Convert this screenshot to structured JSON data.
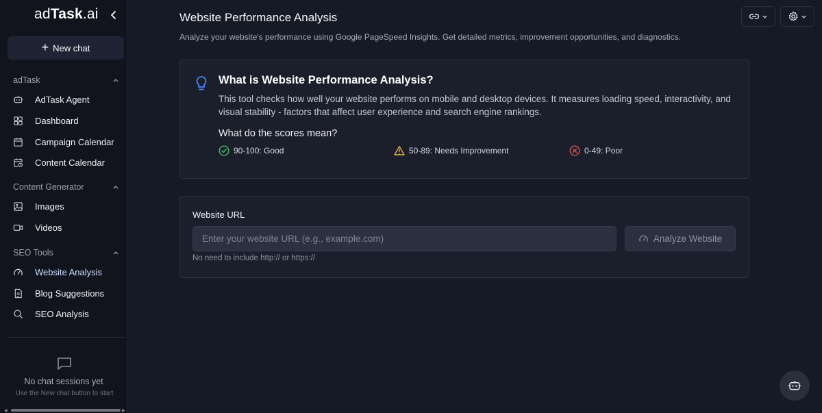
{
  "sidebar": {
    "logo": {
      "prefix": "ad",
      "bold": "Task",
      "suffix": ".ai"
    },
    "new_chat_label": "New chat",
    "sections": [
      {
        "title": "adTask",
        "items": [
          {
            "label": "AdTask Agent",
            "icon": "bot-icon"
          },
          {
            "label": "Dashboard",
            "icon": "grid-icon"
          },
          {
            "label": "Campaign Calendar",
            "icon": "calendar-icon"
          },
          {
            "label": "Content Calendar",
            "icon": "calendar-clock-icon"
          }
        ]
      },
      {
        "title": "Content Generator",
        "items": [
          {
            "label": "Images",
            "icon": "image-icon"
          },
          {
            "label": "Videos",
            "icon": "video-icon"
          }
        ]
      },
      {
        "title": "SEO Tools",
        "items": [
          {
            "label": "Website Analysis",
            "icon": "gauge-icon",
            "active": true
          },
          {
            "label": "Blog Suggestions",
            "icon": "document-icon"
          },
          {
            "label": "SEO Analysis",
            "icon": "search-icon"
          }
        ]
      }
    ],
    "empty_state": {
      "title": "No chat sessions yet",
      "subtitle": "Use the New chat button to start"
    }
  },
  "header": {
    "title": "Website Performance Analysis",
    "subtitle": "Analyze your website's performance using Google PageSpeed Insights. Get detailed metrics, improvement opportunities, and diagnostics."
  },
  "info": {
    "title": "What is Website Performance Analysis?",
    "body": "This tool checks how well your website performs on mobile and desktop devices. It measures loading speed, interactivity, and visual stability - factors that affect user experience and search engine rankings.",
    "scores_title": "What do the scores mean?",
    "scores": [
      {
        "label": "90-100: Good",
        "color": "#3fbf6a"
      },
      {
        "label": "50-89: Needs Improvement",
        "color": "#e7b53a"
      },
      {
        "label": "0-49: Poor",
        "color": "#e2535a"
      }
    ]
  },
  "form": {
    "label": "Website URL",
    "placeholder": "Enter your website URL (e.g., example.com)",
    "value": "",
    "button_label": "Analyze Website",
    "hint": "No need to include http:// or https://"
  },
  "colors": {
    "accent": "#4a8cff",
    "background": "#161a26",
    "sidebar": "#11141d"
  }
}
